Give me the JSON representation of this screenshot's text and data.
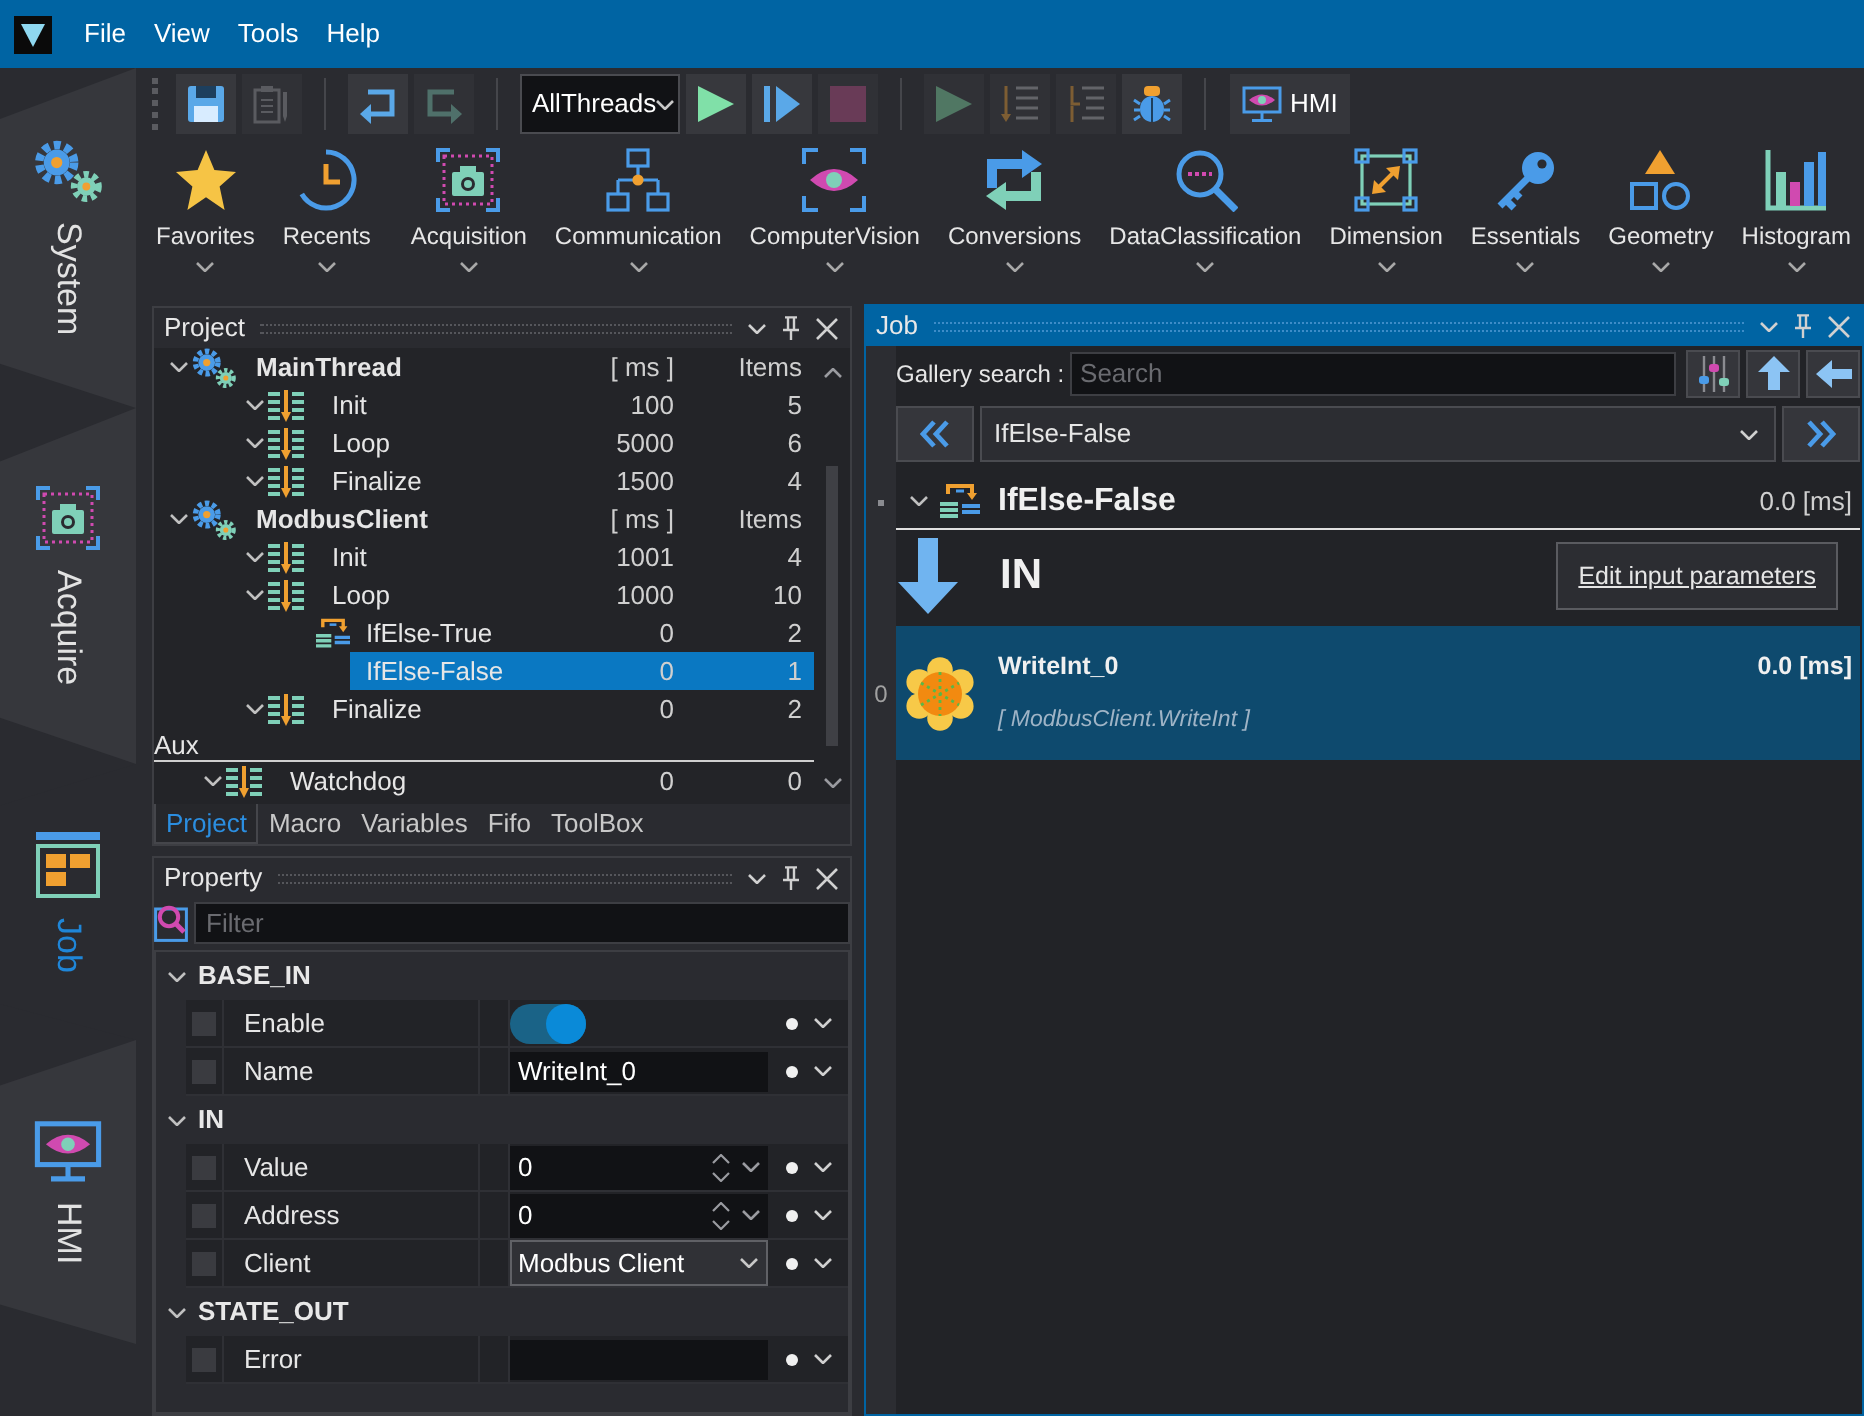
{
  "menu": {
    "items": [
      "File",
      "View",
      "Tools",
      "Help"
    ]
  },
  "side_tabs": [
    {
      "label": "System",
      "selected": false
    },
    {
      "label": "Acquire",
      "selected": false
    },
    {
      "label": "Job",
      "selected": true
    },
    {
      "label": "HMI",
      "selected": false
    }
  ],
  "toolbar": {
    "groups": [
      [
        {
          "kind": "save",
          "disabled": false
        },
        {
          "kind": "notes",
          "disabled": true
        }
      ],
      [
        {
          "kind": "undo",
          "disabled": false
        },
        {
          "kind": "redo",
          "disabled": true
        }
      ],
      [
        {
          "kind": "select",
          "value": "AllThreads"
        },
        {
          "kind": "run",
          "disabled": false
        },
        {
          "kind": "step",
          "disabled": false
        },
        {
          "kind": "stop",
          "disabled": true
        }
      ],
      [
        {
          "kind": "run",
          "disabled": true
        },
        {
          "kind": "indent",
          "disabled": true
        },
        {
          "kind": "outdent",
          "disabled": true
        },
        {
          "kind": "debug",
          "disabled": false
        }
      ],
      [
        {
          "kind": "hmi",
          "label": "HMI"
        }
      ]
    ]
  },
  "ribbon": {
    "groups": [
      [
        "Favorites",
        "Recents"
      ],
      [
        "Acquisition",
        "Communication",
        "ComputerVision",
        "Conversions",
        "DataClassification",
        "Dimension",
        "Essentials",
        "Geometry",
        "Histogram"
      ]
    ]
  },
  "project": {
    "title": "Project",
    "tree": [
      {
        "name": "MainThread",
        "kind": "thread",
        "ms": "[ ms ]",
        "items": "Items",
        "expanded": true,
        "selected": false,
        "children": [
          {
            "name": "Init",
            "kind": "sequence",
            "ms": "100",
            "items": "5",
            "expanded": true,
            "selected": false
          },
          {
            "name": "Loop",
            "kind": "sequence",
            "ms": "5000",
            "items": "6",
            "expanded": true,
            "selected": false
          },
          {
            "name": "Finalize",
            "kind": "sequence",
            "ms": "1500",
            "items": "4",
            "expanded": true,
            "selected": false
          }
        ]
      },
      {
        "name": "ModbusClient",
        "kind": "thread",
        "ms": "[ ms ]",
        "items": "Items",
        "expanded": true,
        "selected": false,
        "children": [
          {
            "name": "Init",
            "kind": "sequence",
            "ms": "1001",
            "items": "4",
            "expanded": true,
            "selected": false
          },
          {
            "name": "Loop",
            "kind": "sequence",
            "ms": "1000",
            "items": "10",
            "expanded": true,
            "selected": false,
            "children": [
              {
                "name": "IfElse-True",
                "kind": "branch",
                "ms": "0",
                "items": "2",
                "selected": false
              },
              {
                "name": "IfElse-False",
                "kind": "plain",
                "ms": "0",
                "items": "1",
                "selected": true
              }
            ]
          },
          {
            "name": "Finalize",
            "kind": "sequence",
            "ms": "0",
            "items": "2",
            "expanded": true,
            "selected": false
          }
        ]
      }
    ],
    "aux": {
      "label": "Aux",
      "tree": [
        {
          "name": "Watchdog",
          "kind": "sequence",
          "ms": "0",
          "items": "0",
          "expanded": true,
          "selected": false
        }
      ]
    },
    "tabs": [
      {
        "label": "Project",
        "selected": true
      },
      {
        "label": "Macro",
        "selected": false
      },
      {
        "label": "Variables",
        "selected": false
      },
      {
        "label": "Fifo",
        "selected": false
      },
      {
        "label": "ToolBox",
        "selected": false
      }
    ]
  },
  "property": {
    "title": "Property",
    "filter": {
      "placeholder": "Filter"
    },
    "categories": [
      {
        "name": "BASE_IN",
        "expanded": true,
        "rows": [
          {
            "label": "Enable",
            "kind": "toggle",
            "checked": false,
            "on": true
          },
          {
            "label": "Name",
            "kind": "text",
            "checked": false,
            "value": "WriteInt_0"
          }
        ]
      },
      {
        "name": "IN",
        "expanded": true,
        "rows": [
          {
            "label": "Value",
            "kind": "number",
            "checked": false,
            "value": "0"
          },
          {
            "label": "Address",
            "kind": "number",
            "checked": false,
            "value": "0"
          },
          {
            "label": "Client",
            "kind": "select",
            "checked": false,
            "value": "Modbus Client"
          }
        ]
      },
      {
        "name": "STATE_OUT",
        "expanded": true,
        "rows": [
          {
            "label": "Error",
            "kind": "text",
            "checked": false
          }
        ]
      }
    ]
  },
  "job": {
    "title": "Job",
    "gallery_search": {
      "label": "Gallery search :",
      "placeholder": "Search"
    },
    "nav": {
      "value": "IfElse-False"
    },
    "header": {
      "title": "IfElse-False",
      "expanded": true,
      "time": "0.0 [ms]"
    },
    "input": {
      "label": "IN",
      "button": "Edit input parameters"
    },
    "items": [
      {
        "index": "0",
        "name": "WriteInt_0",
        "time": "0.0 [ms]",
        "type": "[ ModbusClient.WriteInt ]",
        "selected": true
      }
    ]
  }
}
